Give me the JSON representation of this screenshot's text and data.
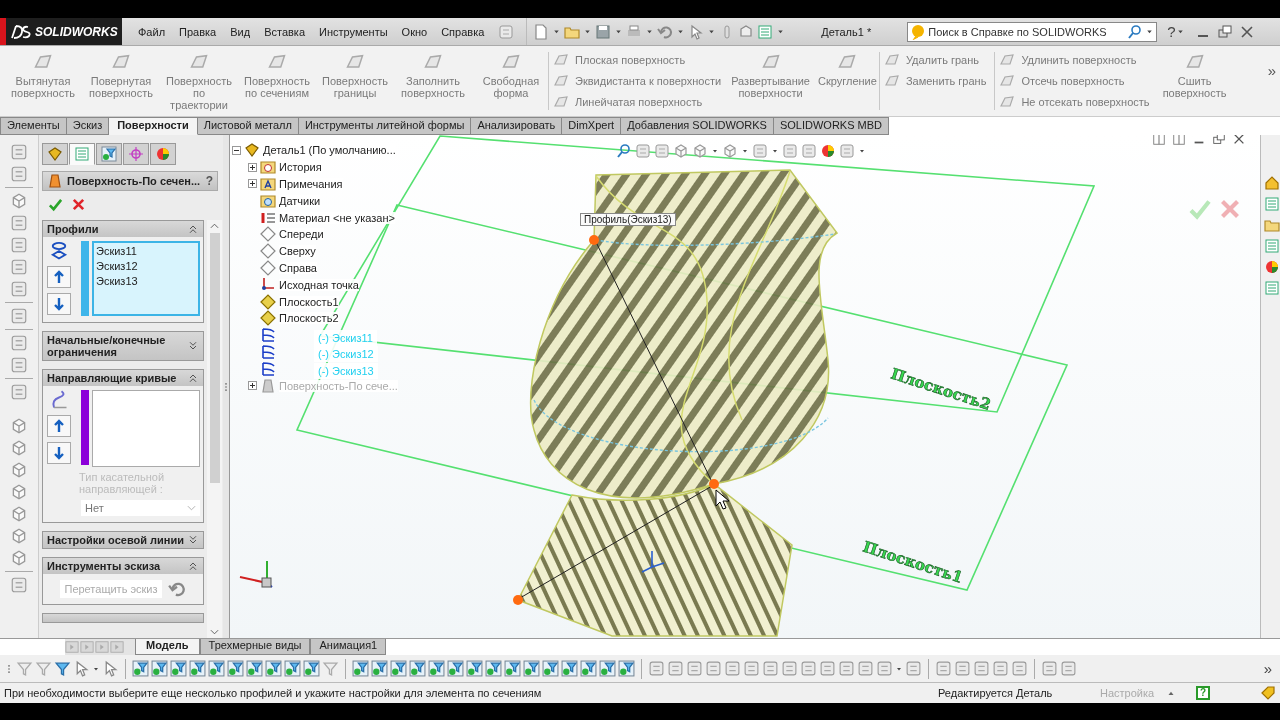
{
  "title_bar": {
    "logo": "SOLIDWORKS",
    "menu": [
      "Файл",
      "Правка",
      "Вид",
      "Вставка",
      "Инструменты",
      "Окно",
      "Справка"
    ],
    "document_title": "Деталь1 *",
    "search": {
      "placeholder": "Поиск в Справке по SOLIDWORKS"
    },
    "help": "?"
  },
  "ribbon": {
    "groups": [
      {
        "kind": "large",
        "items": [
          "Вытянутая поверхность",
          "Повернутая поверхность",
          "Поверхность по траектории",
          "Поверхность по сечениям",
          "Поверхность границы",
          "Заполнить поверхность",
          "Свободная форма"
        ]
      },
      {
        "kind": "small",
        "items": [
          "Плоская поверхность",
          "Эквидистанта к поверхности",
          "Линейчатая поверхность"
        ]
      },
      {
        "kind": "large",
        "items": [
          "Развертывание поверхности",
          "Скругление"
        ]
      },
      {
        "kind": "small",
        "items": [
          "Удалить грань",
          "Заменить грань"
        ]
      },
      {
        "kind": "small",
        "items": [
          "Удлинить поверхность",
          "Отсечь поверхность",
          "Не отсекать поверхность"
        ]
      },
      {
        "kind": "large",
        "items": [
          "Сшить поверхность"
        ]
      }
    ],
    "more": "»"
  },
  "command_tabs": [
    {
      "label": "Элементы",
      "selected": false
    },
    {
      "label": "Эскиз",
      "selected": false
    },
    {
      "label": "Поверхности",
      "selected": true
    },
    {
      "label": "Листовой металл",
      "selected": false
    },
    {
      "label": "Инструменты литейной формы",
      "selected": false
    },
    {
      "label": "Анализировать",
      "selected": false
    },
    {
      "label": "DimXpert",
      "selected": false
    },
    {
      "label": "Добавления SOLIDWORKS",
      "selected": false
    },
    {
      "label": "SOLIDWORKS MBD",
      "selected": false
    }
  ],
  "property_manager": {
    "tabs": [
      {
        "selected": false
      },
      {
        "selected": true
      },
      {
        "selected": false
      },
      {
        "selected": false
      },
      {
        "selected": false
      }
    ],
    "title": "Поверхность-По сечен...",
    "help": "?",
    "sections": [
      {
        "kind": "list",
        "title": "Профили",
        "expanded": true,
        "active": true,
        "color": "#3fb5ea",
        "items": [
          "Эскиз11",
          "Эскиз12",
          "Эскиз13"
        ]
      },
      {
        "title": "Начальные/конечные ограничения",
        "expanded": false
      },
      {
        "kind": "list",
        "title": "Направляющие кривые",
        "expanded": true,
        "active": false,
        "color": "#8c00d9",
        "hint": "Тип касательной направляющей :",
        "select": "Нет"
      },
      {
        "title": "Настройки осевой линии",
        "expanded": false
      },
      {
        "kind": "tools",
        "title": "Инструменты эскиза",
        "expanded": true,
        "button": "Перетащить эскиз"
      }
    ]
  },
  "tree": {
    "label": "Деталь1  (По умолчанию...",
    "expanded": true,
    "children": [
      {
        "label": "История",
        "kind": "history",
        "expanded": false,
        "selected": false,
        "rolled_back": false
      },
      {
        "label": "Примечания",
        "kind": "annotations",
        "expanded": false,
        "selected": false,
        "rolled_back": false
      },
      {
        "label": "Датчики",
        "kind": "sensors",
        "selected": false,
        "rolled_back": false
      },
      {
        "label": "Материал <не указан>",
        "kind": "material",
        "selected": false,
        "rolled_back": false
      },
      {
        "label": "Спереди",
        "kind": "plane",
        "selected": false,
        "rolled_back": false
      },
      {
        "label": "Сверху",
        "kind": "plane",
        "selected": false,
        "rolled_back": false
      },
      {
        "label": "Справа",
        "kind": "plane",
        "selected": false,
        "rolled_back": false
      },
      {
        "label": "Исходная точка",
        "kind": "origin",
        "selected": false,
        "rolled_back": false
      },
      {
        "label": "Плоскость1",
        "kind": "user_plane",
        "selected": false,
        "rolled_back": false
      },
      {
        "label": "Плоскость2",
        "kind": "user_plane",
        "selected": false,
        "rolled_back": false
      },
      {
        "label": "(-) Эскиз11",
        "kind": "sketch",
        "selected": true,
        "rolled_back": false
      },
      {
        "label": "(-) Эскиз12",
        "kind": "sketch",
        "selected": true,
        "rolled_back": false
      },
      {
        "label": "(-) Эскиз13",
        "kind": "sketch",
        "selected": true,
        "rolled_back": false
      },
      {
        "label": "Поверхность-По сече...",
        "kind": "loft",
        "expanded": false,
        "selected": false,
        "rolled_back": true
      }
    ]
  },
  "viewport": {
    "tooltip": "Профиль(Эскиз13)",
    "planes": [
      {
        "label": "Плоскость2"
      },
      {
        "label": "Плоскость1"
      }
    ]
  },
  "bottom_tabs": [
    {
      "label": "Модель",
      "selected": true
    },
    {
      "label": "Трехмерные виды",
      "selected": false
    },
    {
      "label": "Анимация1",
      "selected": false
    }
  ],
  "toolbar": {
    "more": "»"
  },
  "status_bar": {
    "message": "При необходимости выберите еще несколько профилей и укажите настройки для элемента по сечениям",
    "mode": "Редактируется Деталь",
    "configuration": "Настройка",
    "help": "?"
  }
}
